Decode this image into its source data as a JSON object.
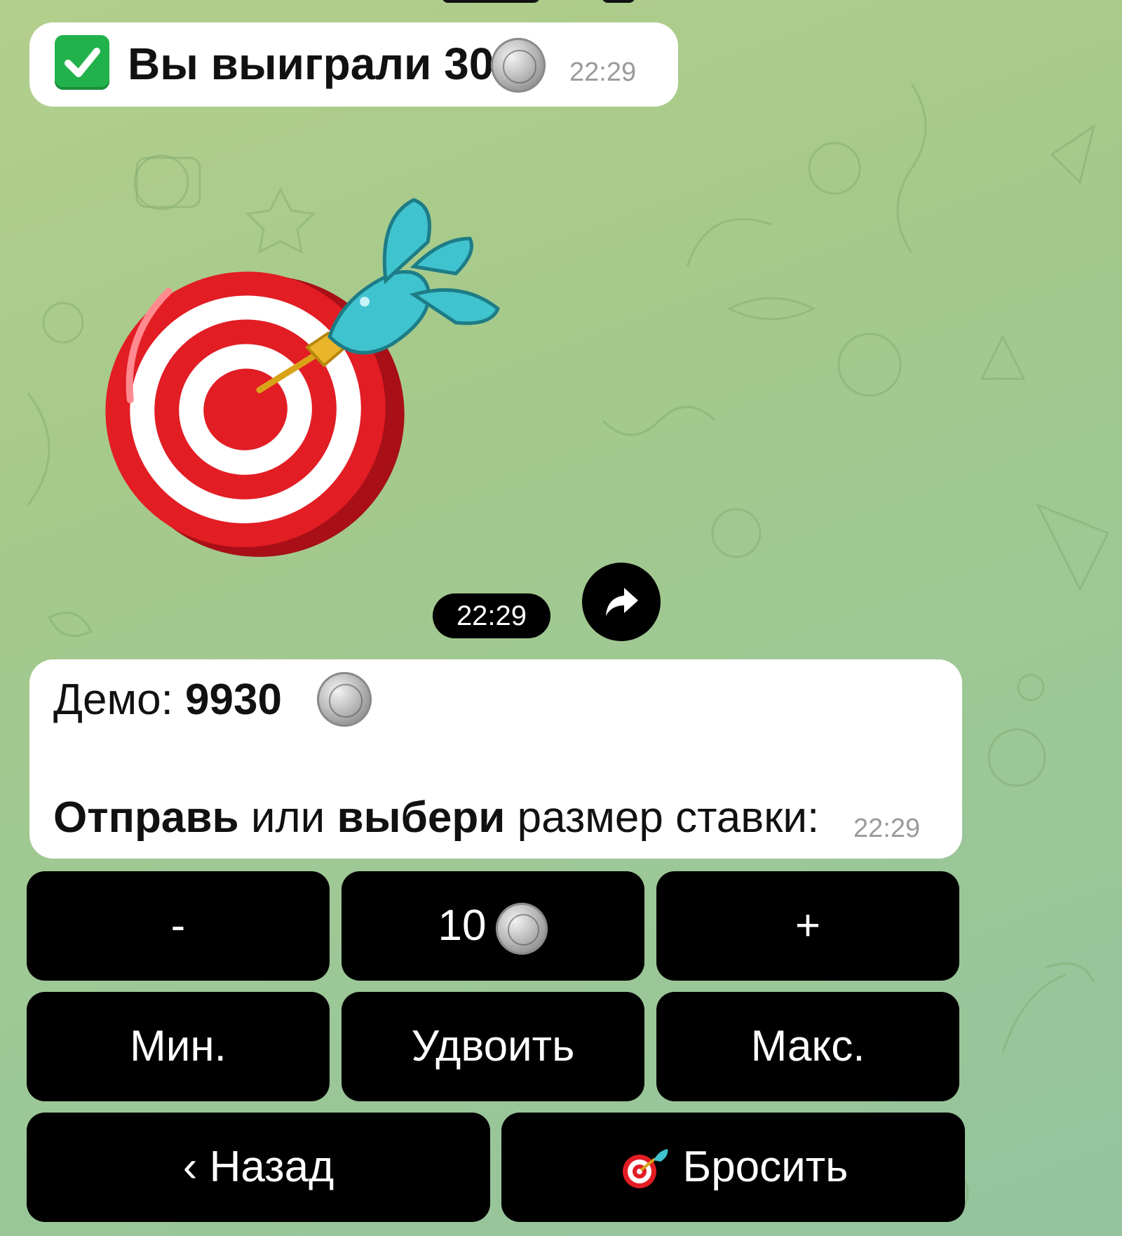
{
  "win_message": {
    "text": "Вы выиграли 30",
    "time": "22:29",
    "icons": [
      "check-mark-icon",
      "coin-icon"
    ]
  },
  "dice_message": {
    "sticker": "darts-target",
    "time": "22:29",
    "forward_icon": "share-arrow-icon"
  },
  "balance_message": {
    "demo_label": "Демо: ",
    "demo_value": "9930",
    "prompt_bold1": "Отправь",
    "prompt_mid": " или ",
    "prompt_bold2": "выбери",
    "prompt_rest": " размер ставки:",
    "time": "22:29"
  },
  "keyboard": {
    "minus": "-",
    "bet_value": "10",
    "plus": "+",
    "min": "Мин.",
    "double": "Удвоить",
    "max": "Макс.",
    "back": "‹ Назад",
    "throw": "Бросить"
  },
  "colors": {
    "background": "#a4c98a",
    "bubble": "#ffffff",
    "keyboard_button": "#000000",
    "check_green": "#22b24c",
    "target_red": "#e21d24",
    "dart_teal": "#3fc3cf"
  }
}
